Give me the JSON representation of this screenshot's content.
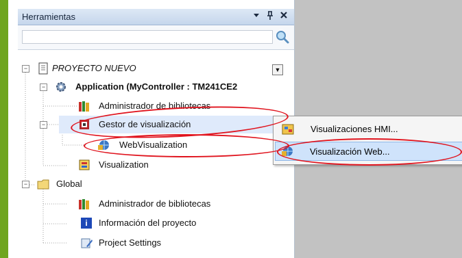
{
  "panel": {
    "title": "Herramientas",
    "dropdown_icon": "triangle-down-icon",
    "pin_label": "y",
    "close_label": "x",
    "search_value": ""
  },
  "tree": {
    "project": "PROYECTO NUEVO",
    "application": "Application (MyController : TM241CE2",
    "lib_admin_1": "Administrador de bibliotecas",
    "viz_manager": "Gestor de visualización",
    "web_viz": "WebVisualization",
    "visualization": "Visualization",
    "global": "Global",
    "lib_admin_2": "Administrador de bibliotecas",
    "project_info": "Información del proyecto",
    "project_settings": "Project Settings"
  },
  "context_menu": {
    "items": [
      {
        "label": "Visualizaciones HMI...",
        "icon": "hmi-visualization-icon"
      },
      {
        "label": "Visualización Web...",
        "icon": "web-visualization-icon"
      }
    ]
  },
  "colors": {
    "annotation_red": "#e0141e",
    "accent_green": "#6fa51f",
    "header_blue": "#c5d6ec",
    "hover_blue": "#cfe3fb"
  }
}
